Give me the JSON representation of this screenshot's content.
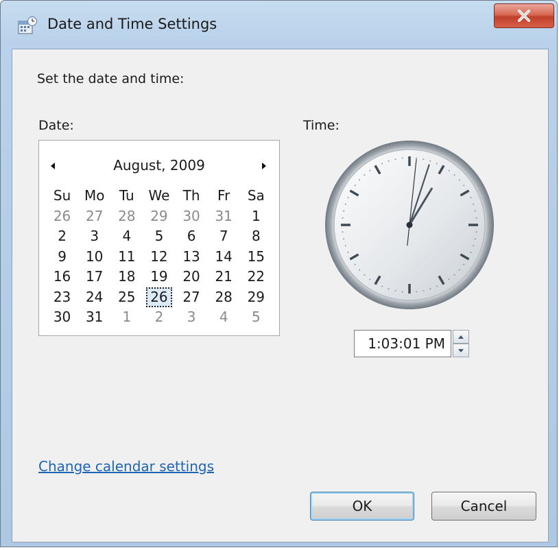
{
  "window": {
    "title": "Date and Time Settings",
    "close_glyph": "X",
    "icon": "date-time-settings-icon"
  },
  "main": {
    "instruction": "Set the date and time:",
    "date_label": "Date:",
    "time_label": "Time:"
  },
  "calendar": {
    "month_year": "August, 2009",
    "prev_icon": "triangle-left-icon",
    "next_icon": "triangle-right-icon",
    "weekdays": [
      "Su",
      "Mo",
      "Tu",
      "We",
      "Th",
      "Fr",
      "Sa"
    ],
    "weeks": [
      [
        {
          "d": "26",
          "dim": true
        },
        {
          "d": "27",
          "dim": true
        },
        {
          "d": "28",
          "dim": true
        },
        {
          "d": "29",
          "dim": true
        },
        {
          "d": "30",
          "dim": true
        },
        {
          "d": "31",
          "dim": true
        },
        {
          "d": "1"
        }
      ],
      [
        {
          "d": "2"
        },
        {
          "d": "3"
        },
        {
          "d": "4"
        },
        {
          "d": "5"
        },
        {
          "d": "6"
        },
        {
          "d": "7"
        },
        {
          "d": "8"
        }
      ],
      [
        {
          "d": "9"
        },
        {
          "d": "10"
        },
        {
          "d": "11"
        },
        {
          "d": "12"
        },
        {
          "d": "13"
        },
        {
          "d": "14"
        },
        {
          "d": "15"
        }
      ],
      [
        {
          "d": "16"
        },
        {
          "d": "17"
        },
        {
          "d": "18"
        },
        {
          "d": "19"
        },
        {
          "d": "20"
        },
        {
          "d": "21"
        },
        {
          "d": "22"
        }
      ],
      [
        {
          "d": "23"
        },
        {
          "d": "24"
        },
        {
          "d": "25"
        },
        {
          "d": "26",
          "selected": true
        },
        {
          "d": "27"
        },
        {
          "d": "28"
        },
        {
          "d": "29"
        }
      ],
      [
        {
          "d": "30"
        },
        {
          "d": "31"
        },
        {
          "d": "1",
          "dim": true
        },
        {
          "d": "2",
          "dim": true
        },
        {
          "d": "3",
          "dim": true
        },
        {
          "d": "4",
          "dim": true
        },
        {
          "d": "5",
          "dim": true
        }
      ]
    ]
  },
  "clock": {
    "hour": 1,
    "minute": 3,
    "second": 1
  },
  "time_field": {
    "value": "1:03:01 PM",
    "spinner_up_icon": "spin-up-icon",
    "spinner_down_icon": "spin-down-icon"
  },
  "footer": {
    "link_label": "Change calendar settings",
    "ok_label": "OK",
    "cancel_label": "Cancel"
  },
  "colors": {
    "link": "#1c64b4",
    "titlebar": "#b9d1ea",
    "close_button": "#c0402a",
    "client_bg": "#f0f0f0"
  }
}
